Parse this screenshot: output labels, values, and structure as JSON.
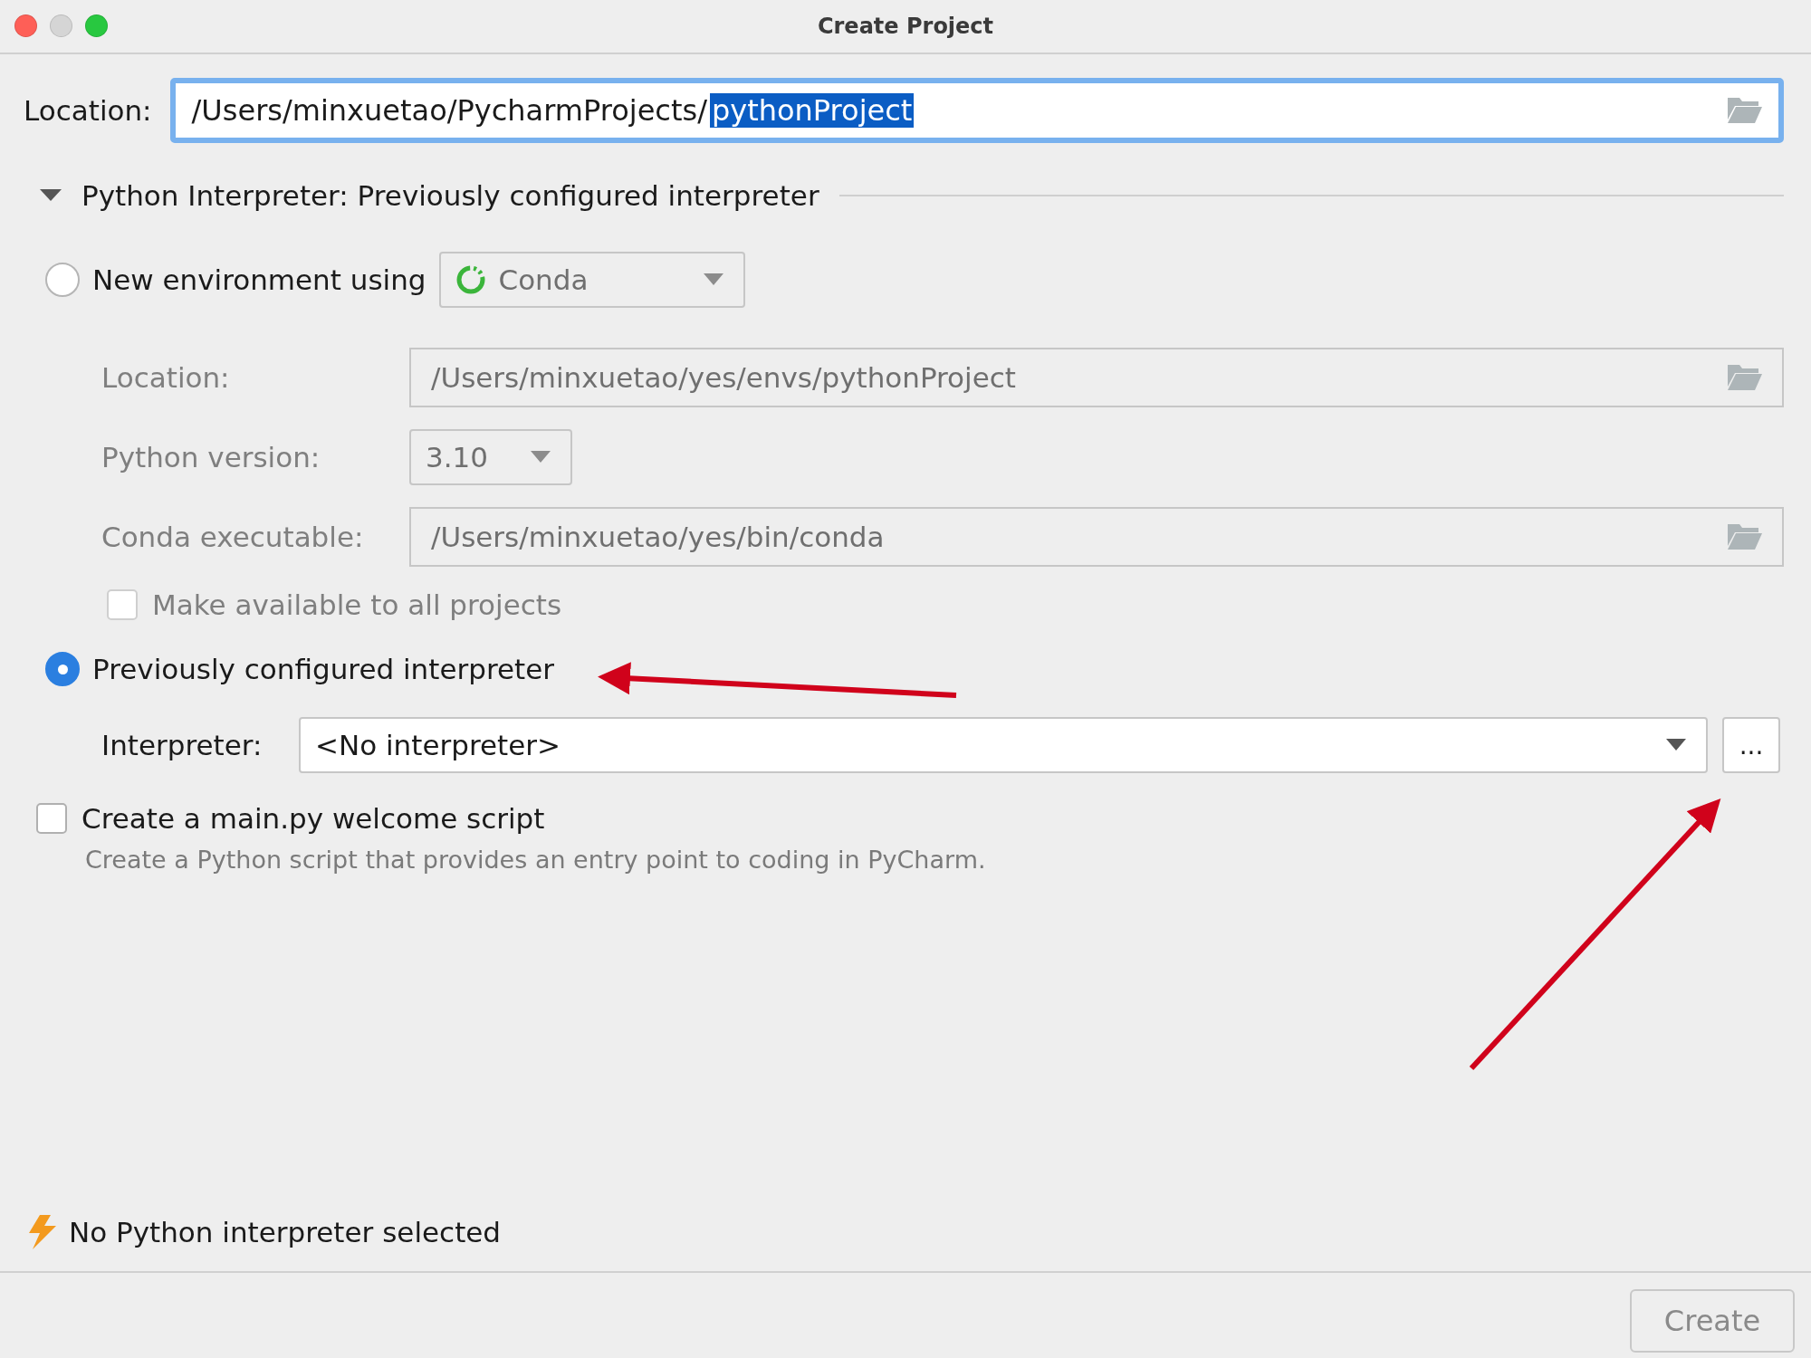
{
  "window": {
    "title": "Create Project"
  },
  "location": {
    "label": "Location:",
    "text_before": "/Users/minxuetao/PycharmProjects/",
    "selected_text": "pythonProject"
  },
  "interpreter_section": {
    "title": "Python Interpreter: Previously configured interpreter",
    "expanded": true
  },
  "new_environment": {
    "label": "New environment using",
    "selected": false,
    "tool": "Conda",
    "disabled": true,
    "fields": [
      {
        "kind": "path",
        "label": "Location:",
        "value": "/Users/minxuetao/yes/envs/pythonProject"
      },
      {
        "kind": "dropdown",
        "label": "Python version:",
        "value": "3.10"
      },
      {
        "kind": "path",
        "label": "Conda executable:",
        "value": "/Users/minxuetao/yes/bin/conda"
      }
    ],
    "make_available": {
      "label": "Make available to all projects",
      "checked": false
    }
  },
  "previous_interpreter": {
    "label": "Previously configured interpreter",
    "selected": true,
    "field_label": "Interpreter:",
    "value": "<No interpreter>",
    "browse_button": "..."
  },
  "welcome_script": {
    "label": "Create a main.py welcome script",
    "checked": false,
    "description": "Create a Python script that provides an entry point to coding in PyCharm."
  },
  "status": {
    "message": "No Python interpreter selected"
  },
  "buttons": [
    {
      "label": "Create",
      "disabled": true
    }
  ]
}
